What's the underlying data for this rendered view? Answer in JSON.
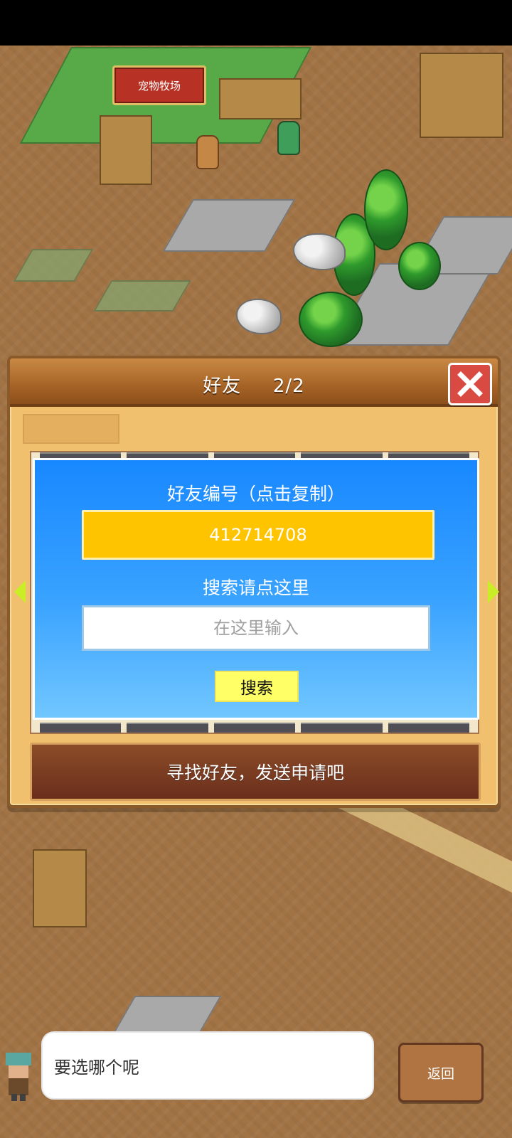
{
  "map": {
    "pet_ranch_label": "宠物牧场"
  },
  "friend_panel": {
    "title": "好友",
    "page_indicator": "2/2",
    "friend_id_label": "好友编号（点击复制）",
    "friend_id": "412714708",
    "search_hint": "搜索请点这里",
    "search_input_placeholder": "在这里输入",
    "search_button_label": "搜索",
    "find_friends_text": "寻找好友，发送申请吧"
  },
  "dialog": {
    "message": "要选哪个呢"
  },
  "navigation": {
    "back_label": "返回"
  },
  "icons": {
    "close": "close-x-icon",
    "left_arrow": "left-arrow-icon",
    "right_arrow": "right-arrow-icon",
    "tab_hint": "tab-strip"
  },
  "colors": {
    "panel_header": "#a56225",
    "friend_id_value_bg": "#ffc400",
    "search_button_bg": "#ffff66",
    "close_button_bg": "#d94b42"
  }
}
